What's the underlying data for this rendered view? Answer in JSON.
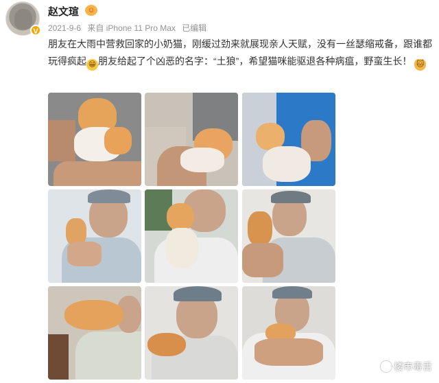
{
  "post": {
    "username": "赵文瑄",
    "date": "2021-9-6",
    "source": "来自 iPhone 11 Pro Max",
    "edited": "已编辑",
    "text_part1": "朋友在大雨中营救回家的小奶猫，刚缓过劲来就展现亲人天赋，没有一丝瑟缩戒备，跟谁都玩得疯起",
    "text_part2": "朋友给起了个凶恶的名字：“土狼”，希望猫咪能驱退各种病瘟，野蛮生长！",
    "emoji_laugh": "😁",
    "emoji_cat": "🐱"
  },
  "icons": {
    "avatar": "avatar-cat-photo",
    "verified": "verified-badge-icon",
    "vip": "vip-face-icon"
  },
  "photos": [
    {
      "id": "kitten-on-arm"
    },
    {
      "id": "kitten-held-lap"
    },
    {
      "id": "kitten-blue-shirt"
    },
    {
      "id": "man-grey-cap-kitten-1"
    },
    {
      "id": "man-kitten-chest-1"
    },
    {
      "id": "man-kitten-side-1"
    },
    {
      "id": "kitten-on-shoulder"
    },
    {
      "id": "man-cap-kitten-chin"
    },
    {
      "id": "man-hugging-kitten"
    }
  ],
  "watermark": {
    "text": "楼市毒舌"
  },
  "colors": {
    "text": "#333333",
    "meta": "#939393",
    "verified": "#f7a600"
  }
}
